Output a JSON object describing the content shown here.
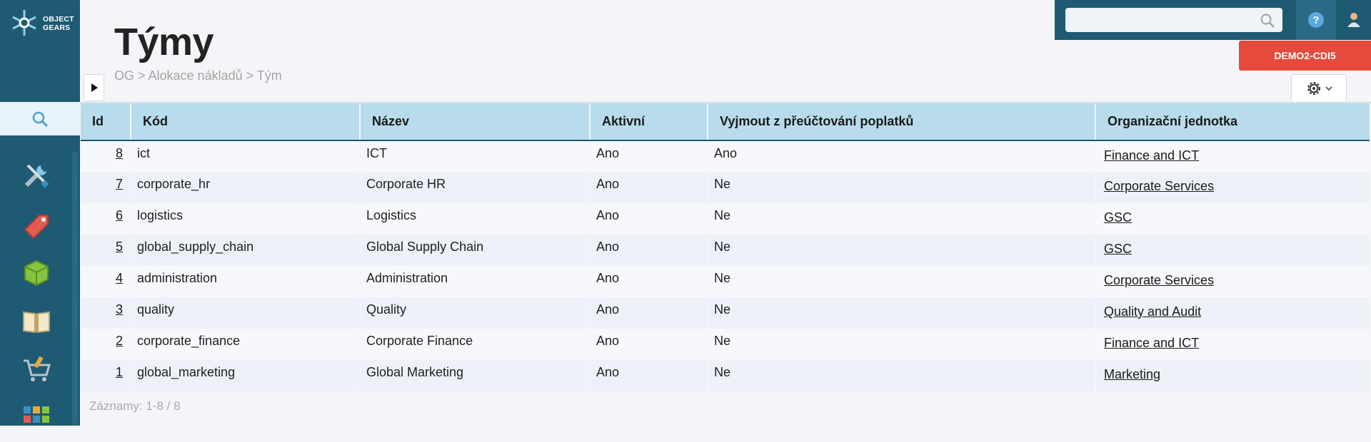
{
  "brand": {
    "logo_line1": "OBJECT",
    "logo_line2": "GEARS"
  },
  "page": {
    "title": "Týmy",
    "breadcrumb": "OG > Alokace nákladů > Tým"
  },
  "top": {
    "search_placeholder": "",
    "env_badge": "DEMO2-CDI5"
  },
  "sidebar": {
    "icons": [
      "tools-icon",
      "tag-icon",
      "cubes-icon",
      "book-icon",
      "cart-icon",
      "apps-icon"
    ]
  },
  "table": {
    "columns": [
      "Id",
      "Kód",
      "Název",
      "Aktivní",
      "Vyjmout z přeúčtování poplatků",
      "Organizační jednotka"
    ],
    "rows": [
      {
        "id": "8",
        "code": "ict",
        "name": "ICT",
        "active": "Ano",
        "exempt": "Ano",
        "org": "Finance and ICT"
      },
      {
        "id": "7",
        "code": "corporate_hr",
        "name": "Corporate HR",
        "active": "Ano",
        "exempt": "Ne",
        "org": "Corporate Services"
      },
      {
        "id": "6",
        "code": "logistics",
        "name": "Logistics",
        "active": "Ano",
        "exempt": "Ne",
        "org": "GSC"
      },
      {
        "id": "5",
        "code": "global_supply_chain",
        "name": "Global Supply Chain",
        "active": "Ano",
        "exempt": "Ne",
        "org": "GSC"
      },
      {
        "id": "4",
        "code": "administration",
        "name": "Administration",
        "active": "Ano",
        "exempt": "Ne",
        "org": "Corporate Services"
      },
      {
        "id": "3",
        "code": "quality",
        "name": "Quality",
        "active": "Ano",
        "exempt": "Ne",
        "org": "Quality and Audit"
      },
      {
        "id": "2",
        "code": "corporate_finance",
        "name": "Corporate Finance",
        "active": "Ano",
        "exempt": "Ne",
        "org": "Finance and ICT"
      },
      {
        "id": "1",
        "code": "global_marketing",
        "name": "Global Marketing",
        "active": "Ano",
        "exempt": "Ne",
        "org": "Marketing"
      }
    ]
  },
  "footer": {
    "records": "Záznamy: 1-8 / 8"
  },
  "colors": {
    "sidebar": "#1f5a73",
    "header_row": "#b8dcec",
    "badge": "#e54b3d"
  }
}
